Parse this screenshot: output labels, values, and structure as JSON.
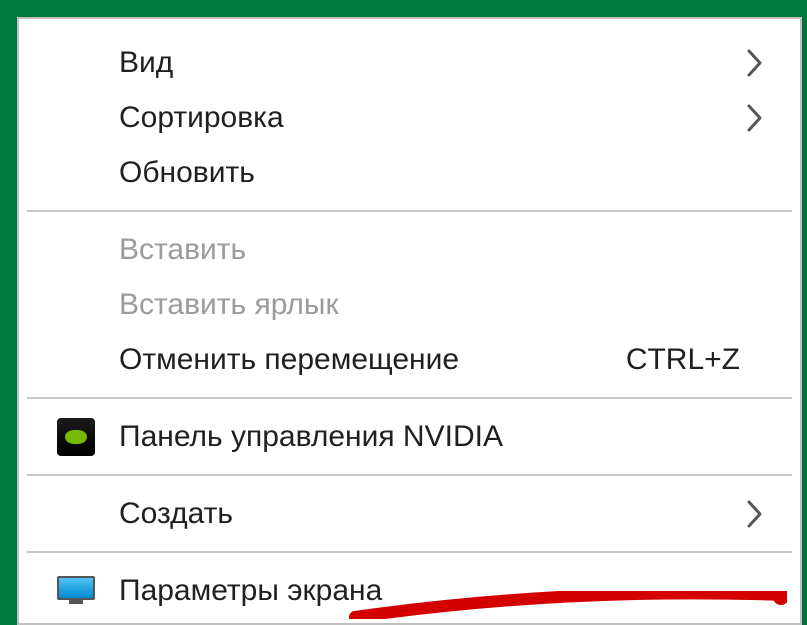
{
  "menu": {
    "view": {
      "label": "Вид",
      "has_submenu": true
    },
    "sort": {
      "label": "Сортировка",
      "has_submenu": true
    },
    "refresh": {
      "label": "Обновить"
    },
    "paste": {
      "label": "Вставить",
      "disabled": true
    },
    "paste_shortcut": {
      "label": "Вставить ярлык",
      "disabled": true
    },
    "undo_move": {
      "label": "Отменить перемещение",
      "shortcut": "CTRL+Z"
    },
    "nvidia_panel": {
      "label": "Панель управления NVIDIA"
    },
    "create": {
      "label": "Создать",
      "has_submenu": true
    },
    "display_settings": {
      "label": "Параметры экрана"
    }
  },
  "icons": {
    "chevron_right": "chevron-right-icon",
    "nvidia": "nvidia-icon",
    "display": "display-icon"
  }
}
